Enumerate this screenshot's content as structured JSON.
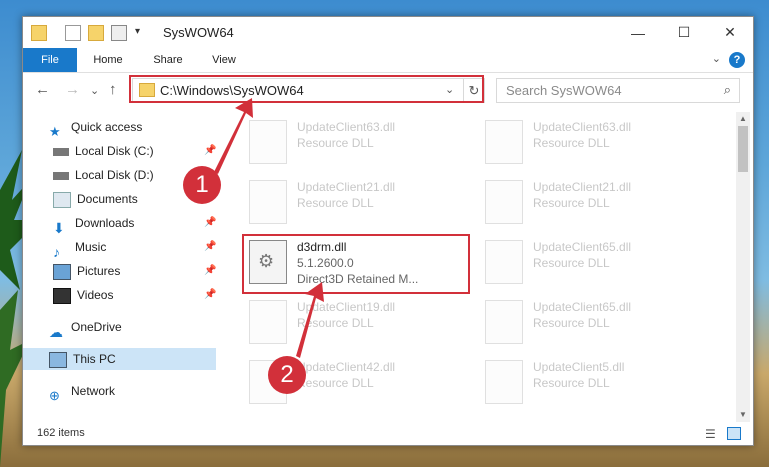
{
  "window": {
    "title": "SysWOW64",
    "ribbon_tabs": [
      "File",
      "Home",
      "Share",
      "View"
    ]
  },
  "address_bar": {
    "path": "C:\\Windows\\SysWOW64",
    "search_placeholder": "Search SysWOW64"
  },
  "sidebar": {
    "items": [
      {
        "label": "Quick access",
        "icon": "star-icon"
      },
      {
        "label": "Local Disk (C:)",
        "icon": "drive-icon",
        "pinned": true
      },
      {
        "label": "Local Disk (D:)",
        "icon": "drive-icon"
      },
      {
        "label": "Documents",
        "icon": "documents-icon",
        "pinned": true
      },
      {
        "label": "Downloads",
        "icon": "download-icon",
        "pinned": true
      },
      {
        "label": "Music",
        "icon": "music-icon",
        "pinned": true
      },
      {
        "label": "Pictures",
        "icon": "pictures-icon",
        "pinned": true
      },
      {
        "label": "Videos",
        "icon": "videos-icon",
        "pinned": true
      },
      {
        "label": "OneDrive",
        "icon": "cloud-icon"
      },
      {
        "label": "This PC",
        "icon": "computer-icon",
        "selected": true
      },
      {
        "label": "Network",
        "icon": "network-icon"
      }
    ]
  },
  "files": [
    {
      "name": "UpdateClient63.dll",
      "type": "Resource DLL",
      "faded": true
    },
    {
      "name": "UpdateClient63.dll",
      "type": "Resource DLL",
      "faded": true
    },
    {
      "name": "UpdateClient21.dll",
      "type": "Resource DLL",
      "faded": true
    },
    {
      "name": "UpdateClient21.dll",
      "type": "Resource DLL",
      "faded": true
    },
    {
      "name": "d3drm.dll",
      "version": "5.1.2600.0",
      "description": "Direct3D Retained M...",
      "faded": false
    },
    {
      "name": "UpdateClient65.dll",
      "type": "Resource DLL",
      "faded": true
    },
    {
      "name": "UpdateClient19.dll",
      "type": "Resource DLL",
      "faded": true
    },
    {
      "name": "UpdateClient65.dll",
      "type": "Resource DLL",
      "faded": true
    },
    {
      "name": "UpdateClient42.dll",
      "type": "Resource DLL",
      "faded": true
    },
    {
      "name": "UpdateClient5.dll",
      "type": "Resource DLL",
      "faded": true
    }
  ],
  "status": {
    "item_count": "162 items"
  },
  "callouts": {
    "one": "1",
    "two": "2"
  },
  "colors": {
    "accent": "#1979ca",
    "highlight": "#d2303a",
    "selected": "#cce4f7"
  }
}
